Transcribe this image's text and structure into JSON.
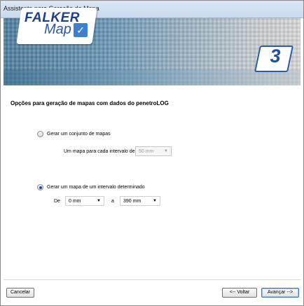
{
  "window": {
    "title": "Assistente para Geração de Mapa"
  },
  "banner": {
    "logo_top": "FALKER",
    "logo_bottom": "Map",
    "step_number": "3"
  },
  "page": {
    "heading": "Opções para geração de mapas com dados do penetroLOG",
    "option1": {
      "label": "Gerar um conjunto de mapas",
      "selected": false,
      "interval_label": "Um mapa para cada intervalo de",
      "interval_value": "50 mm",
      "interval_enabled": false
    },
    "option2": {
      "label": "Gerar um mapa de um intervalo determinado",
      "selected": true,
      "from_label": "De",
      "from_value": "0 mm",
      "to_label": "a",
      "to_value": "390 mm"
    }
  },
  "footer": {
    "cancel_label": "Cancelar",
    "back_label": "<-- Voltar",
    "next_label": "Avançar -->"
  }
}
